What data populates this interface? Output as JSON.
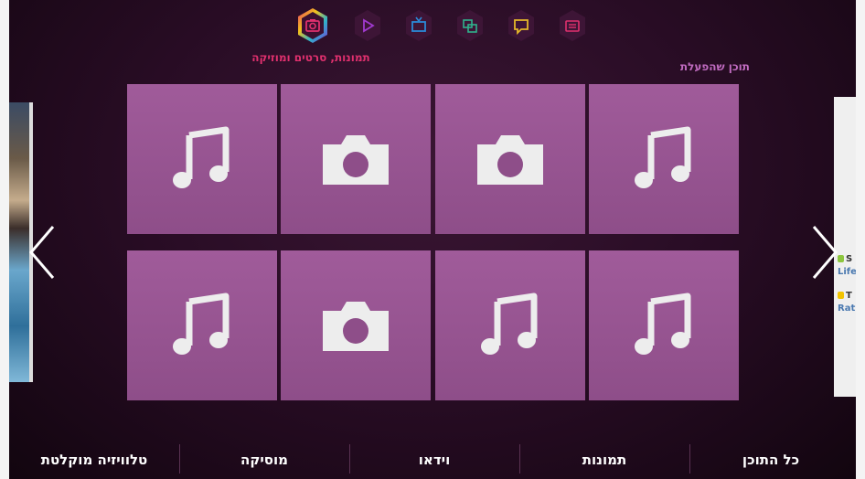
{
  "top_bar": {
    "items": [
      {
        "icon": "camera-icon",
        "color": "#e0306e",
        "active": true
      },
      {
        "icon": "play-icon",
        "color": "#a13ad0"
      },
      {
        "icon": "tv-icon",
        "color": "#2a8ad8"
      },
      {
        "icon": "apps-icon",
        "color": "#2fb38d"
      },
      {
        "icon": "chat-icon",
        "color": "#e5b82a"
      },
      {
        "icon": "web-browser-icon",
        "color": "#e0306e"
      }
    ],
    "active_label": "תמונות, סרטים ומוזיקה"
  },
  "section": {
    "title": "תוכן שהפעלת"
  },
  "tiles": [
    {
      "icon": "music-icon"
    },
    {
      "icon": "camera-icon"
    },
    {
      "icon": "camera-icon"
    },
    {
      "icon": "music-icon"
    },
    {
      "icon": "music-icon"
    },
    {
      "icon": "camera-icon"
    },
    {
      "icon": "music-icon"
    },
    {
      "icon": "music-icon"
    }
  ],
  "right_peek": {
    "line1": "S",
    "line2": "Life",
    "line3": "T",
    "line4": "Rath"
  },
  "bottom_nav": {
    "items": [
      {
        "label": "טלוויזיה מוקלטת"
      },
      {
        "label": "מוסיקה"
      },
      {
        "label": "וידאו"
      },
      {
        "label": "תמונות"
      },
      {
        "label": "כל התוכן"
      }
    ]
  },
  "colors": {
    "tile": "#9a5695",
    "background": "#2a0d26",
    "accent": "#e0306e"
  }
}
